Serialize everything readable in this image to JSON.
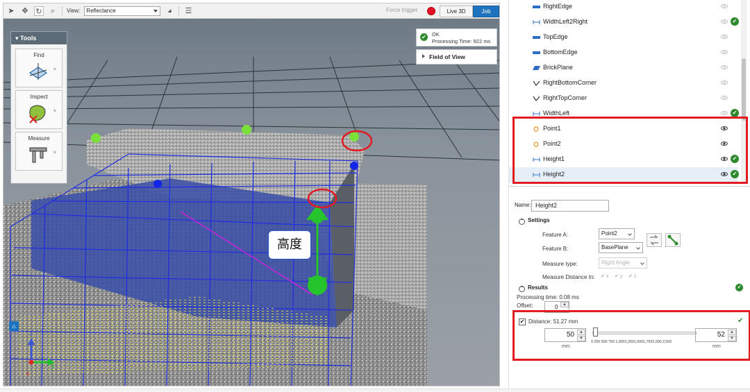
{
  "toolbar": {
    "icons": [
      "pointer-icon",
      "pan-icon",
      "rotate-icon",
      "zoom-icon",
      "palette-icon",
      "list-icon"
    ],
    "view_label": "View:",
    "view_value": "Reflectance",
    "force_trigger": "Force trigger",
    "live3d": "Live 3D",
    "job": "Job",
    "colors": {
      "accent": "#1e73be",
      "record": "#e4102a"
    }
  },
  "tools": {
    "title": "▾ Tools",
    "items": [
      {
        "label": "Find",
        "icon": "find-axes-icon"
      },
      {
        "label": "Inspect",
        "icon": "inspect-shape-icon"
      },
      {
        "label": "Measure",
        "icon": "caliper-icon"
      }
    ]
  },
  "status": {
    "state": "OK",
    "processing_time": "Processing Time: 922 ms",
    "field_of_view": "Field of View"
  },
  "overlay": {
    "height_label": "高度"
  },
  "feature_tree": {
    "items": [
      {
        "name": "RightEdge",
        "icon": "edge-icon",
        "visible": false,
        "ok": false,
        "selected": false
      },
      {
        "name": "WidthLeft2Right",
        "icon": "width-icon",
        "visible": false,
        "ok": true,
        "selected": false
      },
      {
        "name": "TopEdge",
        "icon": "edge-icon",
        "visible": false,
        "ok": false,
        "selected": false
      },
      {
        "name": "BottomEdge",
        "icon": "edge-icon",
        "visible": false,
        "ok": false,
        "selected": false
      },
      {
        "name": "BrickPlane",
        "icon": "plane-icon",
        "visible": false,
        "ok": false,
        "selected": false
      },
      {
        "name": "RightBottomCorner",
        "icon": "corner-icon",
        "visible": false,
        "ok": false,
        "selected": false
      },
      {
        "name": "RightTopCorner",
        "icon": "corner-icon",
        "visible": false,
        "ok": false,
        "selected": false
      },
      {
        "name": "WidthLeft",
        "icon": "width-icon",
        "visible": false,
        "ok": true,
        "selected": false
      },
      {
        "name": "Point1",
        "icon": "point-icon",
        "visible": true,
        "ok": false,
        "selected": false
      },
      {
        "name": "Point2",
        "icon": "point-icon",
        "visible": true,
        "ok": false,
        "selected": false
      },
      {
        "name": "Height1",
        "icon": "width-icon",
        "visible": true,
        "ok": true,
        "selected": false
      },
      {
        "name": "Height2",
        "icon": "width-icon",
        "visible": true,
        "ok": true,
        "selected": true
      }
    ]
  },
  "properties": {
    "name_label": "Name:",
    "name_value": "Height2",
    "settings_title": "Settings",
    "feature_a_label": "Feature A:",
    "feature_a_value": "Point2",
    "feature_b_label": "Feature B:",
    "feature_b_value": "BasePlane",
    "measure_type_label": "Measure type:",
    "measure_type_value": "Right Angle",
    "measure_distance_label": "Measure Distance In:",
    "axes": [
      "x",
      "y",
      "z"
    ],
    "results_title": "Results",
    "processing_time": "Processing time: 0.08 ms",
    "offset_label": "Offset:",
    "offset_value": "0",
    "distance_label": "Distance: 51.27 mm",
    "min_value": "50",
    "max_value": "52",
    "unit": "mm",
    "slider_ticks": "0  250  500  750 1,0001,2501,5001,7502,000        2,500",
    "slider_level": 0.02
  }
}
